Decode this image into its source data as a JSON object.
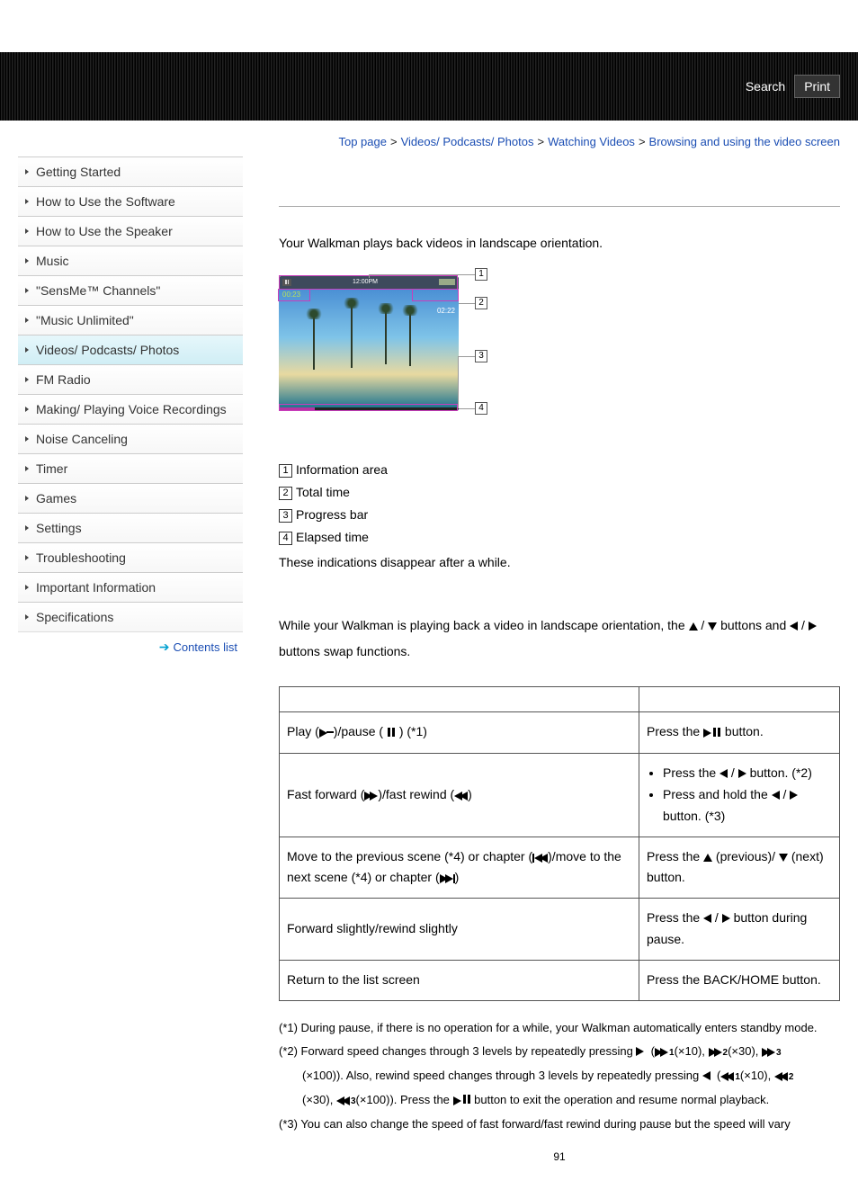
{
  "topbar": {
    "search": "Search",
    "print": "Print"
  },
  "nav": {
    "items": [
      "Getting Started",
      "How to Use the Software",
      "How to Use the Speaker",
      "Music",
      "\"SensMe™ Channels\"",
      "\"Music Unlimited\"",
      "Videos/ Podcasts/ Photos",
      "FM Radio",
      "Making/ Playing Voice Recordings",
      "Noise Canceling",
      "Timer",
      "Games",
      "Settings",
      "Troubleshooting",
      "Important Information",
      "Specifications"
    ],
    "active_index": 6,
    "contents_list": "Contents list"
  },
  "breadcrumb": {
    "items": [
      "Top page",
      "Videos/ Podcasts/ Photos",
      "Watching Videos"
    ],
    "current": "Browsing and using the video screen"
  },
  "intro": "Your Walkman plays back videos in landscape orientation.",
  "diagram": {
    "time_center": "12:00PM",
    "total_time": "02:22",
    "elapsed": "00:23"
  },
  "legend": {
    "items": [
      "Information area",
      "Total time",
      "Progress bar",
      "Elapsed time"
    ],
    "note": "These indications disappear after a while."
  },
  "swap": {
    "part1": "While your Walkman is playing back a video in landscape orientation, the ",
    "sep": " / ",
    "part2": " buttons and ",
    "part3": " buttons swap functions."
  },
  "table": {
    "rows": [
      {
        "left_a": "Play (",
        "left_b": ")/pause ( ",
        "left_c": " ) (*1)",
        "right_a": "Press the ",
        "right_b": " button."
      },
      {
        "left_a": "Fast forward (",
        "left_b": ")/fast rewind (",
        "left_c": ")",
        "r1a": "Press the ",
        "r1b": " / ",
        "r1c": " button. (*2)",
        "r2a": "Press and hold the ",
        "r2b": " / ",
        "r2c": " button. (*3)"
      },
      {
        "left_a": "Move to the previous scene (*4) or chapter (",
        "left_b": ")/move to the next scene (*4) or chapter (",
        "left_c": ")",
        "right_a": "Press the ",
        "right_b": " (previous)/ ",
        "right_c": " (next) button."
      },
      {
        "left": "Forward slightly/rewind slightly",
        "right_a": "Press the ",
        "right_b": " / ",
        "right_c": " button during pause."
      },
      {
        "left": "Return to the list screen",
        "right": "Press the BACK/HOME button."
      }
    ]
  },
  "footnotes": {
    "f1": "(*1) During pause, if there is no operation for a while, your Walkman automatically enters standby mode.",
    "f2a": "(*2) Forward speed changes through 3 levels by repeatedly pressing ",
    "f2_x10": "(×10), ",
    "f2_x30": "(×30), ",
    "f2b": "(×100)). Also, rewind speed changes through 3 levels by repeatedly pressing ",
    "f2c": "(×30), ",
    "f2d": "(×100)). Press the ",
    "f2e": " button to exit the operation and resume normal playback.",
    "f3": "(*3) You can also change the speed of fast forward/fast rewind during pause but the speed will vary"
  },
  "speed_labels": {
    "s1": "1",
    "s2": "2",
    "s3": "3"
  },
  "page_number": "91"
}
